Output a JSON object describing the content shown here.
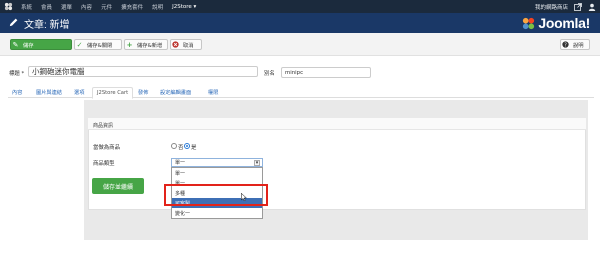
{
  "navbar": {
    "menu": [
      "系統",
      "會員",
      "選單",
      "內容",
      "元件",
      "擴充套件",
      "說明",
      "J2Store ▾"
    ],
    "store_label": "我的網路商店",
    "icons": [
      "joomla-logo-icon",
      "external-link-icon",
      "user-icon"
    ]
  },
  "header": {
    "title": "文章: 新增",
    "brand": "Joomla!"
  },
  "toolbar": {
    "save": "儲存",
    "save_close": "儲存&關閉",
    "save_new": "儲存&新增",
    "cancel": "取消",
    "help": "說明"
  },
  "form": {
    "title_label": "標題 *",
    "title_value": "小鋼砲迷你電腦",
    "alias_label": "別名",
    "alias_value": "minipc"
  },
  "tabs": [
    "內容",
    "圖片與連結",
    "選項",
    "J2Store Cart",
    "發佈",
    "設定編輯畫面",
    "權限"
  ],
  "active_tab": "J2Store Cart",
  "panel": {
    "title": "商品資訊",
    "treat_as_product_label": "當做為商品",
    "radio_no": "否",
    "radio_yes": "是",
    "product_type_label": "商品類型",
    "select_value": "單一",
    "options": [
      "單一",
      "單一",
      "多種",
      "可客製",
      "變化一"
    ],
    "highlighted_option": "可客製",
    "save_continue": "儲存並繼續"
  },
  "colors": {
    "navbar_bg": "#1b2a3d",
    "header_bg": "#1a3867",
    "save_green": "#46a546",
    "highlight_blue": "#3d6fb5",
    "annotation_red": "#e2231a"
  }
}
